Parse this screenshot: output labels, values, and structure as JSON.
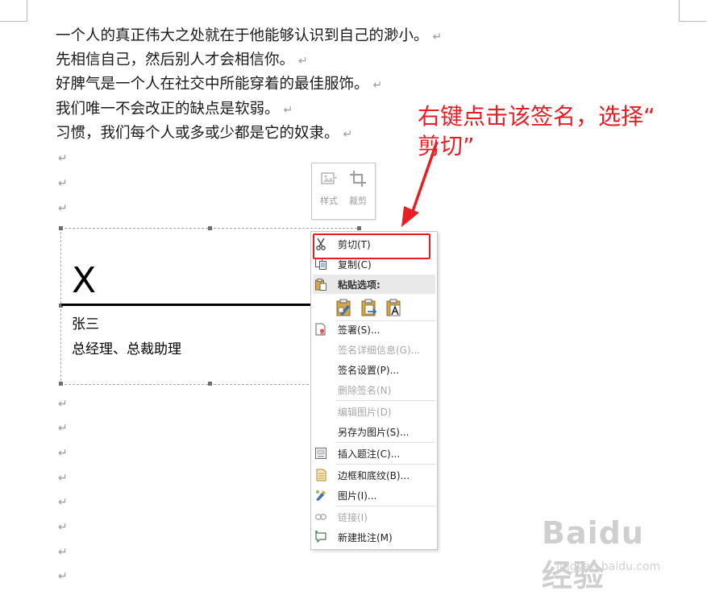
{
  "document": {
    "paragraph_mark": "↵",
    "lines": [
      "一个人的真正伟大之处就在于他能够认识到自己的渺小。",
      "先相信自己，然后别人才会相信你。",
      "好脾气是一个人在社交中所能穿着的最佳服饰。",
      "我们唯一不会改正的缺点是软弱。",
      "习惯，我们每个人或多或少都是它的奴隶。"
    ]
  },
  "mini_toolbar": {
    "style_label": "样式",
    "crop_label": "裁剪"
  },
  "signature": {
    "x_mark": "X",
    "name": "张三",
    "title": "总经理、总裁助理"
  },
  "context_menu": {
    "cut": "剪切(T)",
    "copy": "复制(C)",
    "paste_options": "粘贴选项:",
    "sign": "签署(S)...",
    "signature_details": "签名详细信息(G)...",
    "signature_setup": "签名设置(P)...",
    "remove_signature": "删除签名(N)",
    "edit_picture": "编辑图片(D)",
    "save_as_picture": "另存为图片(S)...",
    "insert_caption": "插入题注(C)...",
    "borders_shading": "边框和底纹(B)...",
    "picture": "图片(I)...",
    "link": "链接(I)",
    "new_comment": "新建批注(M)"
  },
  "annotation": {
    "line1": "右键点击该签名，选择“",
    "line2": "剪切”",
    "color": "#e61e25"
  },
  "watermark": {
    "logo": "Baidu经验",
    "url": "jingyan.baidu.com"
  }
}
